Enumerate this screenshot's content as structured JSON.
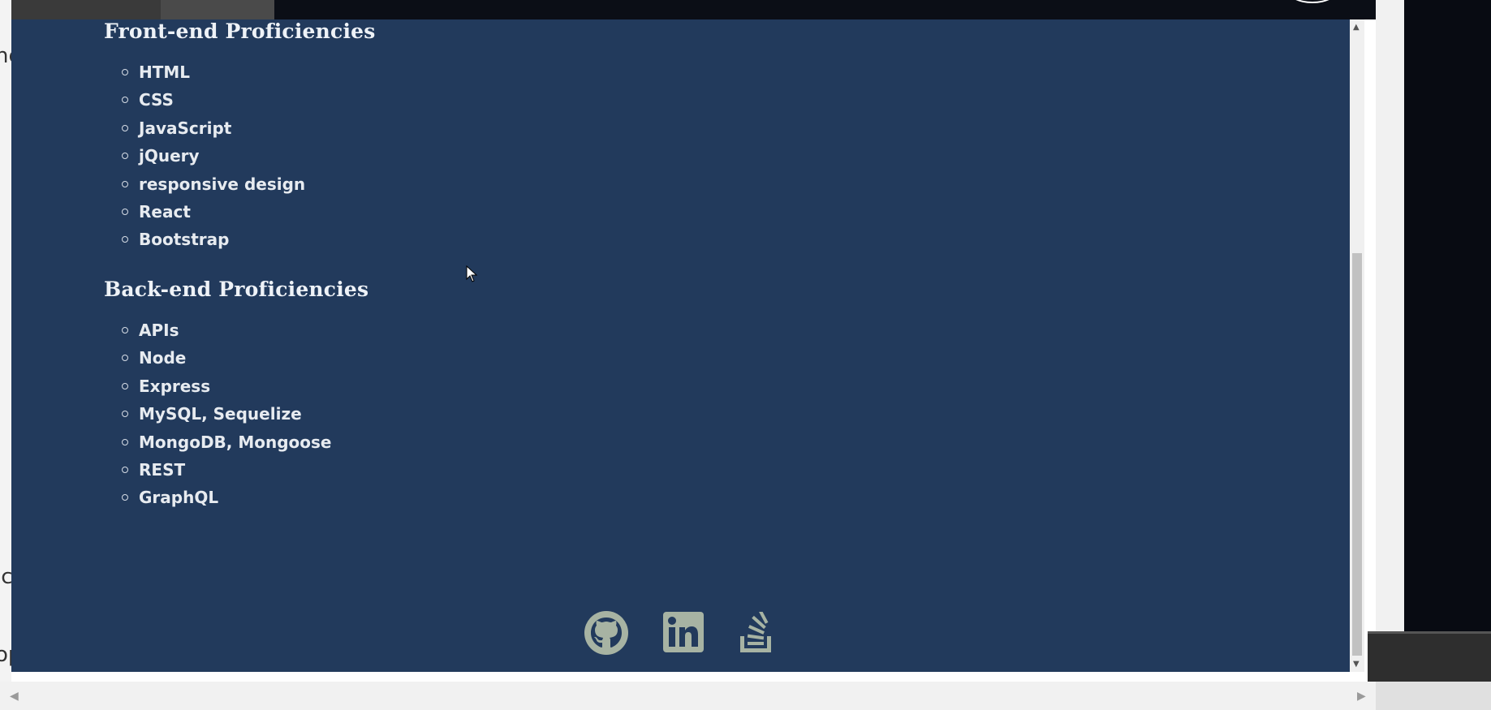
{
  "background": {
    "left_fragments": [
      "ne",
      "ic",
      "op"
    ]
  },
  "front_end": {
    "title": "Front-end Proficiencies",
    "items": [
      "HTML",
      "CSS",
      "JavaScript",
      "jQuery",
      "responsive design",
      "React",
      "Bootstrap"
    ]
  },
  "back_end": {
    "title": "Back-end Proficiencies",
    "items": [
      "APIs",
      "Node",
      "Express",
      "MySQL, Sequelize",
      "MongoDB, Mongoose",
      "REST",
      "GraphQL"
    ]
  },
  "social": {
    "icons": [
      "github-icon",
      "linkedin-icon",
      "stackoverflow-icon"
    ]
  },
  "colors": {
    "modal_bg": "#223a5c",
    "text": "#e7ebf0",
    "icon": "#a7b3a3"
  }
}
